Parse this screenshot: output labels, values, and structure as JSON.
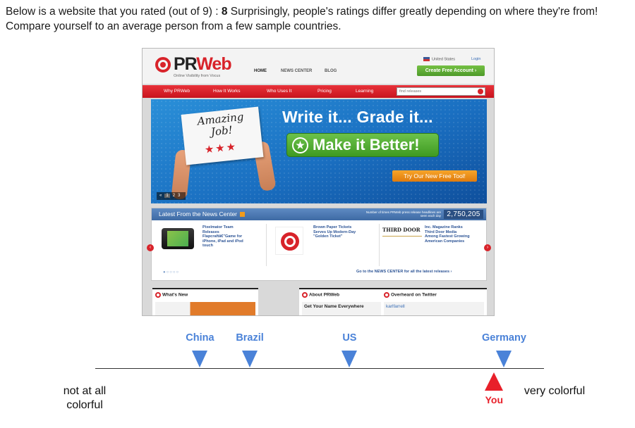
{
  "intro": {
    "text_before": "Below is a website that you rated (out of 9) : ",
    "rating": "8",
    "text_after": " Surprisingly, people's ratings differ greatly depending on where they're from! Compare yourself to an average person from a few sample countries."
  },
  "site": {
    "logo_text_pr": "PR",
    "logo_text_web": "Web",
    "logo_tagline": "Online Visibility from Vocus",
    "top_nav": [
      "HOME",
      "NEWS CENTER",
      "BLOG"
    ],
    "locale": "United States",
    "login": "Login",
    "create_account": "Create Free Account ›",
    "red_nav": [
      "Why PRWeb",
      "How It Works",
      "Who Uses It",
      "Pricing",
      "Learning"
    ],
    "search_placeholder": "find releases",
    "hero": {
      "sign_text": "Amazing Job!",
      "sign_stars": "★★★",
      "headline": "Write it... Grade it...",
      "cta": "Make it Better!",
      "try_button": "Try Our New Free Tool!",
      "pager": [
        "«",
        "1",
        "2",
        "3"
      ]
    },
    "latest": {
      "title": "Latest From the News Center",
      "counter_label": "Number of times PRWeb press release headlines are seen each day",
      "counter_value": "2,750,205",
      "items": [
        "Pixelmator Team Releases Flapcraftâ€\"Game for iPhone, iPad and iPod touch",
        "Brown Paper Tickets Serves Up Modern-Day \"Golden Ticket\"",
        "Inc. Magazine Ranks Third Door Media Among Fastest Growing American Companies"
      ],
      "tdm_logo": "THIRD DOOR",
      "dots": "●○○○○",
      "goto_link": "Go to the NEWS CENTER for all the latest releases ›"
    },
    "panels": [
      {
        "title": "What's New",
        "body": ""
      },
      {
        "title": "About PRWeb",
        "body": "Get Your Name Everywhere"
      },
      {
        "title": "Overheard on Twitter",
        "body": "karlfarrell"
      }
    ]
  },
  "scale": {
    "countries": [
      {
        "name": "China",
        "value": 2.1
      },
      {
        "name": "Brazil",
        "value": 3.1
      },
      {
        "name": "US",
        "value": 5.1
      },
      {
        "name": "Germany",
        "value": 8.2
      }
    ],
    "you_label": "You",
    "you_value": 8,
    "left_label": "not at all colorful",
    "right_label": "very colorful",
    "range": [
      0,
      9
    ],
    "colors": {
      "countries": "#4a82d8",
      "you": "#e8202a"
    }
  }
}
